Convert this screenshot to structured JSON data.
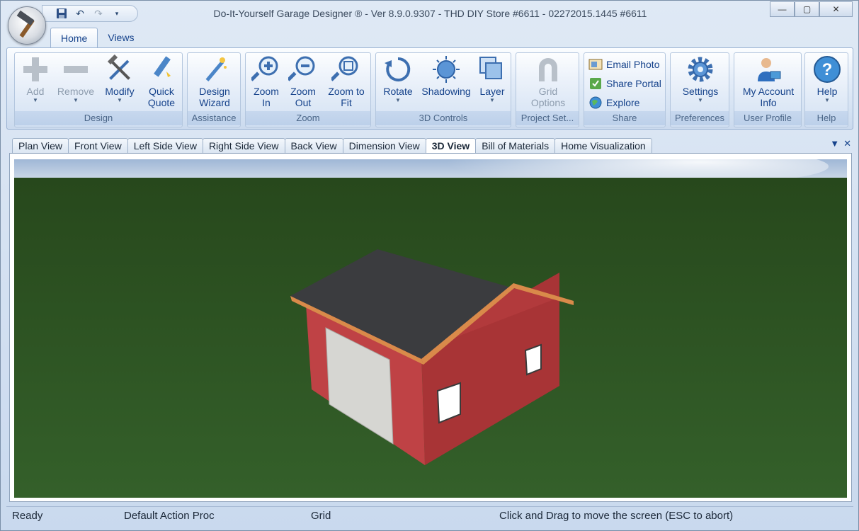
{
  "window": {
    "title": "Do-It-Yourself Garage Designer ® - Ver 8.9.0.9307 - THD DIY Store #6611 - 02272015.1445 #6611",
    "controls": {
      "minimize": "—",
      "maximize": "▢",
      "close": "✕"
    }
  },
  "quick_access": {
    "save_icon": "save-icon",
    "undo_icon": "undo-icon",
    "redo_icon": "redo-icon",
    "customize_icon": "dropdown-icon"
  },
  "ribbon_tabs": [
    {
      "label": "Home",
      "active": true
    },
    {
      "label": "Views",
      "active": false
    }
  ],
  "ribbon": {
    "design": {
      "label": "Design",
      "add": "Add",
      "remove": "Remove",
      "modify": "Modify",
      "quick_quote_1": "Quick",
      "quick_quote_2": "Quote"
    },
    "assistance": {
      "label": "Assistance",
      "wizard_1": "Design",
      "wizard_2": "Wizard"
    },
    "zoom": {
      "label": "Zoom",
      "in_1": "Zoom",
      "in_2": "In",
      "out_1": "Zoom",
      "out_2": "Out",
      "fit_1": "Zoom to",
      "fit_2": "Fit"
    },
    "controls3d": {
      "label": "3D Controls",
      "rotate": "Rotate",
      "shadowing": "Shadowing",
      "layer": "Layer"
    },
    "project": {
      "label": "Project Set...",
      "grid_1": "Grid",
      "grid_2": "Options"
    },
    "share": {
      "label": "Share",
      "email": "Email Photo",
      "portal": "Share Portal",
      "explore": "Explore"
    },
    "preferences": {
      "label": "Preferences",
      "settings": "Settings"
    },
    "user_profile": {
      "label": "User Profile",
      "account_1": "My Account",
      "account_2": "Info"
    },
    "help": {
      "label": "Help",
      "help": "Help"
    }
  },
  "view_tabs": [
    {
      "label": "Plan View",
      "active": false
    },
    {
      "label": "Front View",
      "active": false
    },
    {
      "label": "Left Side View",
      "active": false
    },
    {
      "label": "Right Side View",
      "active": false
    },
    {
      "label": "Back View",
      "active": false
    },
    {
      "label": "Dimension View",
      "active": false
    },
    {
      "label": "3D View",
      "active": true
    },
    {
      "label": "Bill of Materials",
      "active": false
    },
    {
      "label": "Home Visualization",
      "active": false
    }
  ],
  "tab_controls": {
    "dropdown": "▼",
    "close": "✕"
  },
  "statusbar": {
    "ready": "Ready",
    "action": "Default Action Proc",
    "grid": "Grid",
    "hint": "Click and Drag to move the screen  (ESC to abort)"
  },
  "colors": {
    "accent": "#15428b",
    "grass": "#2f5a22",
    "siding": "#b8393c",
    "roof": "#3a3b3d",
    "trim": "#d98a4a"
  }
}
